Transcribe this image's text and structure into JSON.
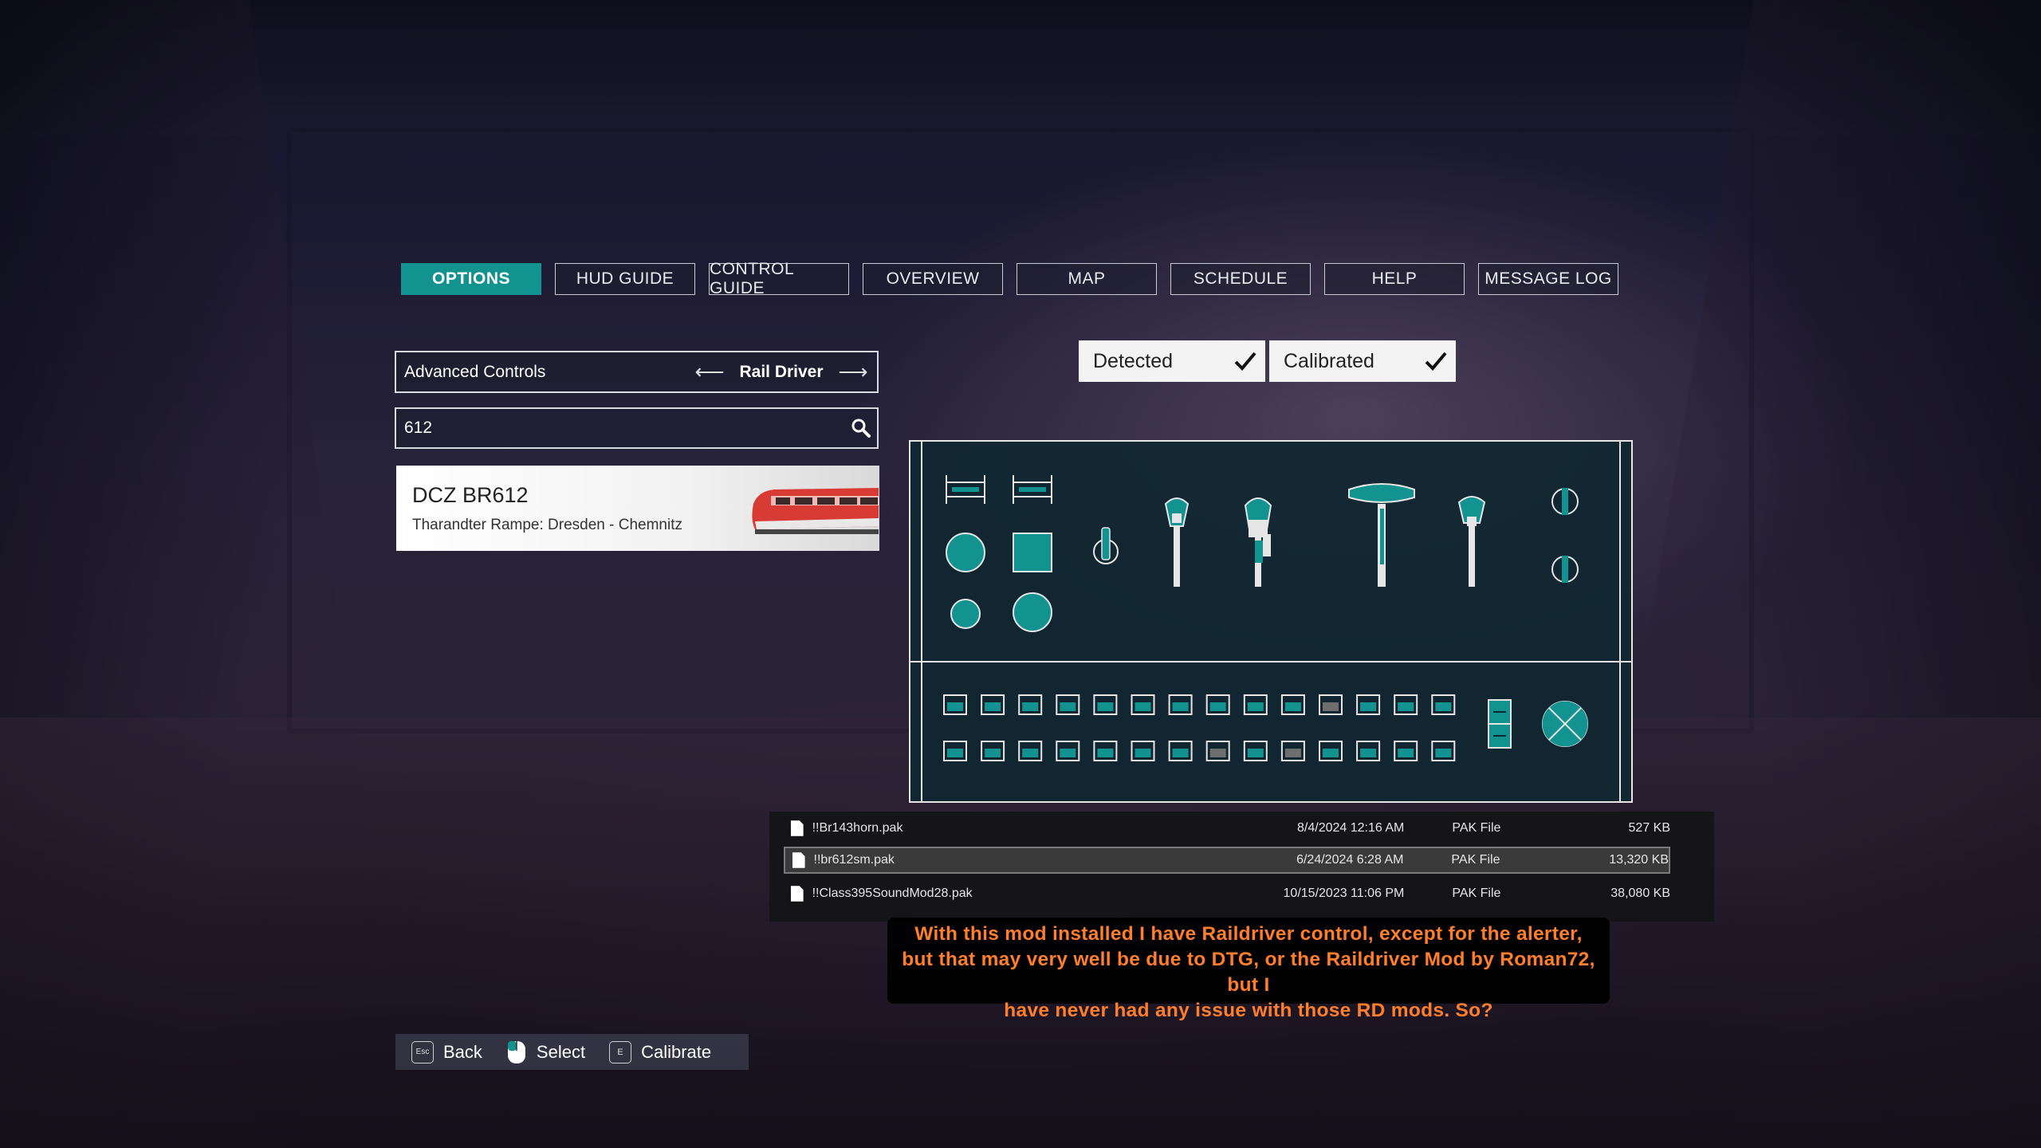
{
  "tabs": [
    {
      "label": "OPTIONS",
      "active": true
    },
    {
      "label": "HUD GUIDE",
      "active": false
    },
    {
      "label": "CONTROL GUIDE",
      "active": false
    },
    {
      "label": "OVERVIEW",
      "active": false
    },
    {
      "label": "MAP",
      "active": false
    },
    {
      "label": "SCHEDULE",
      "active": false
    },
    {
      "label": "HELP",
      "active": false
    },
    {
      "label": "MESSAGE LOG",
      "active": false
    }
  ],
  "controls": {
    "category_label": "Advanced Controls",
    "device_value": "Rail Driver",
    "prev_icon": "arrow-left-icon",
    "next_icon": "arrow-right-icon"
  },
  "search": {
    "value": "612",
    "icon": "search-icon"
  },
  "train": {
    "title": "DCZ BR612",
    "route": "Tharandter Rampe: Dresden - Chemnitz"
  },
  "status": {
    "detected_label": "Detected",
    "calibrated_label": "Calibrated",
    "detected": true,
    "calibrated": true
  },
  "files": [
    {
      "name": "!!Br143horn.pak",
      "date": "8/4/2024 12:16 AM",
      "type": "PAK File",
      "size": "527 KB",
      "selected": false
    },
    {
      "name": "!!br612sm.pak",
      "date": "6/24/2024 6:28 AM",
      "type": "PAK File",
      "size": "13,320 KB",
      "selected": true
    },
    {
      "name": "!!Class395SoundMod28.pak",
      "date": "10/15/2023 11:06 PM",
      "type": "PAK File",
      "size": "38,080 KB",
      "selected": false
    }
  ],
  "comment": {
    "line1": "With this mod installed I have Raildriver control, except for the alerter,",
    "line2": "but that may very well be due to DTG, or the Raildriver Mod by Roman72, but I",
    "line3": "have never had any issue with those RD mods.  So?"
  },
  "hints": [
    {
      "key": "Esc",
      "label": "Back"
    },
    {
      "key": "mouse-icon",
      "label": "Select"
    },
    {
      "key": "E",
      "label": "Calibrate"
    }
  ],
  "colors": {
    "accent": "#13938f",
    "comment_text": "#ff7e2b",
    "panel_bg": "#0f2a32"
  }
}
